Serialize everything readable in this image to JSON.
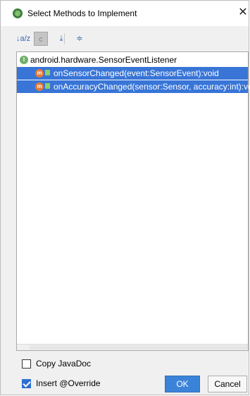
{
  "window": {
    "title": "Select Methods to Implement",
    "close_symbol": "✕"
  },
  "toolbar": {
    "sort_label": "↓a/z",
    "show_classes_label": "c",
    "expand_all_symbol": "⤓",
    "collapse_all_symbol": "≑"
  },
  "tree": {
    "interface": {
      "icon_letter": "I",
      "label": "android.hardware.SensorEventListener"
    },
    "methods": [
      {
        "icon_letter": "m",
        "label": "onSensorChanged(event:SensorEvent):void",
        "selected": true
      },
      {
        "icon_letter": "m",
        "label": "onAccuracyChanged(sensor:Sensor, accuracy:int):void",
        "selected": true
      }
    ]
  },
  "options": {
    "copy_javadoc": {
      "label": "Copy JavaDoc",
      "checked": false
    },
    "insert_override": {
      "label": "Insert @Override",
      "checked": true
    }
  },
  "buttons": {
    "ok": "OK",
    "cancel": "Cancel"
  },
  "colors": {
    "selection": "#3875d7",
    "ok_button": "#3b83d8"
  }
}
